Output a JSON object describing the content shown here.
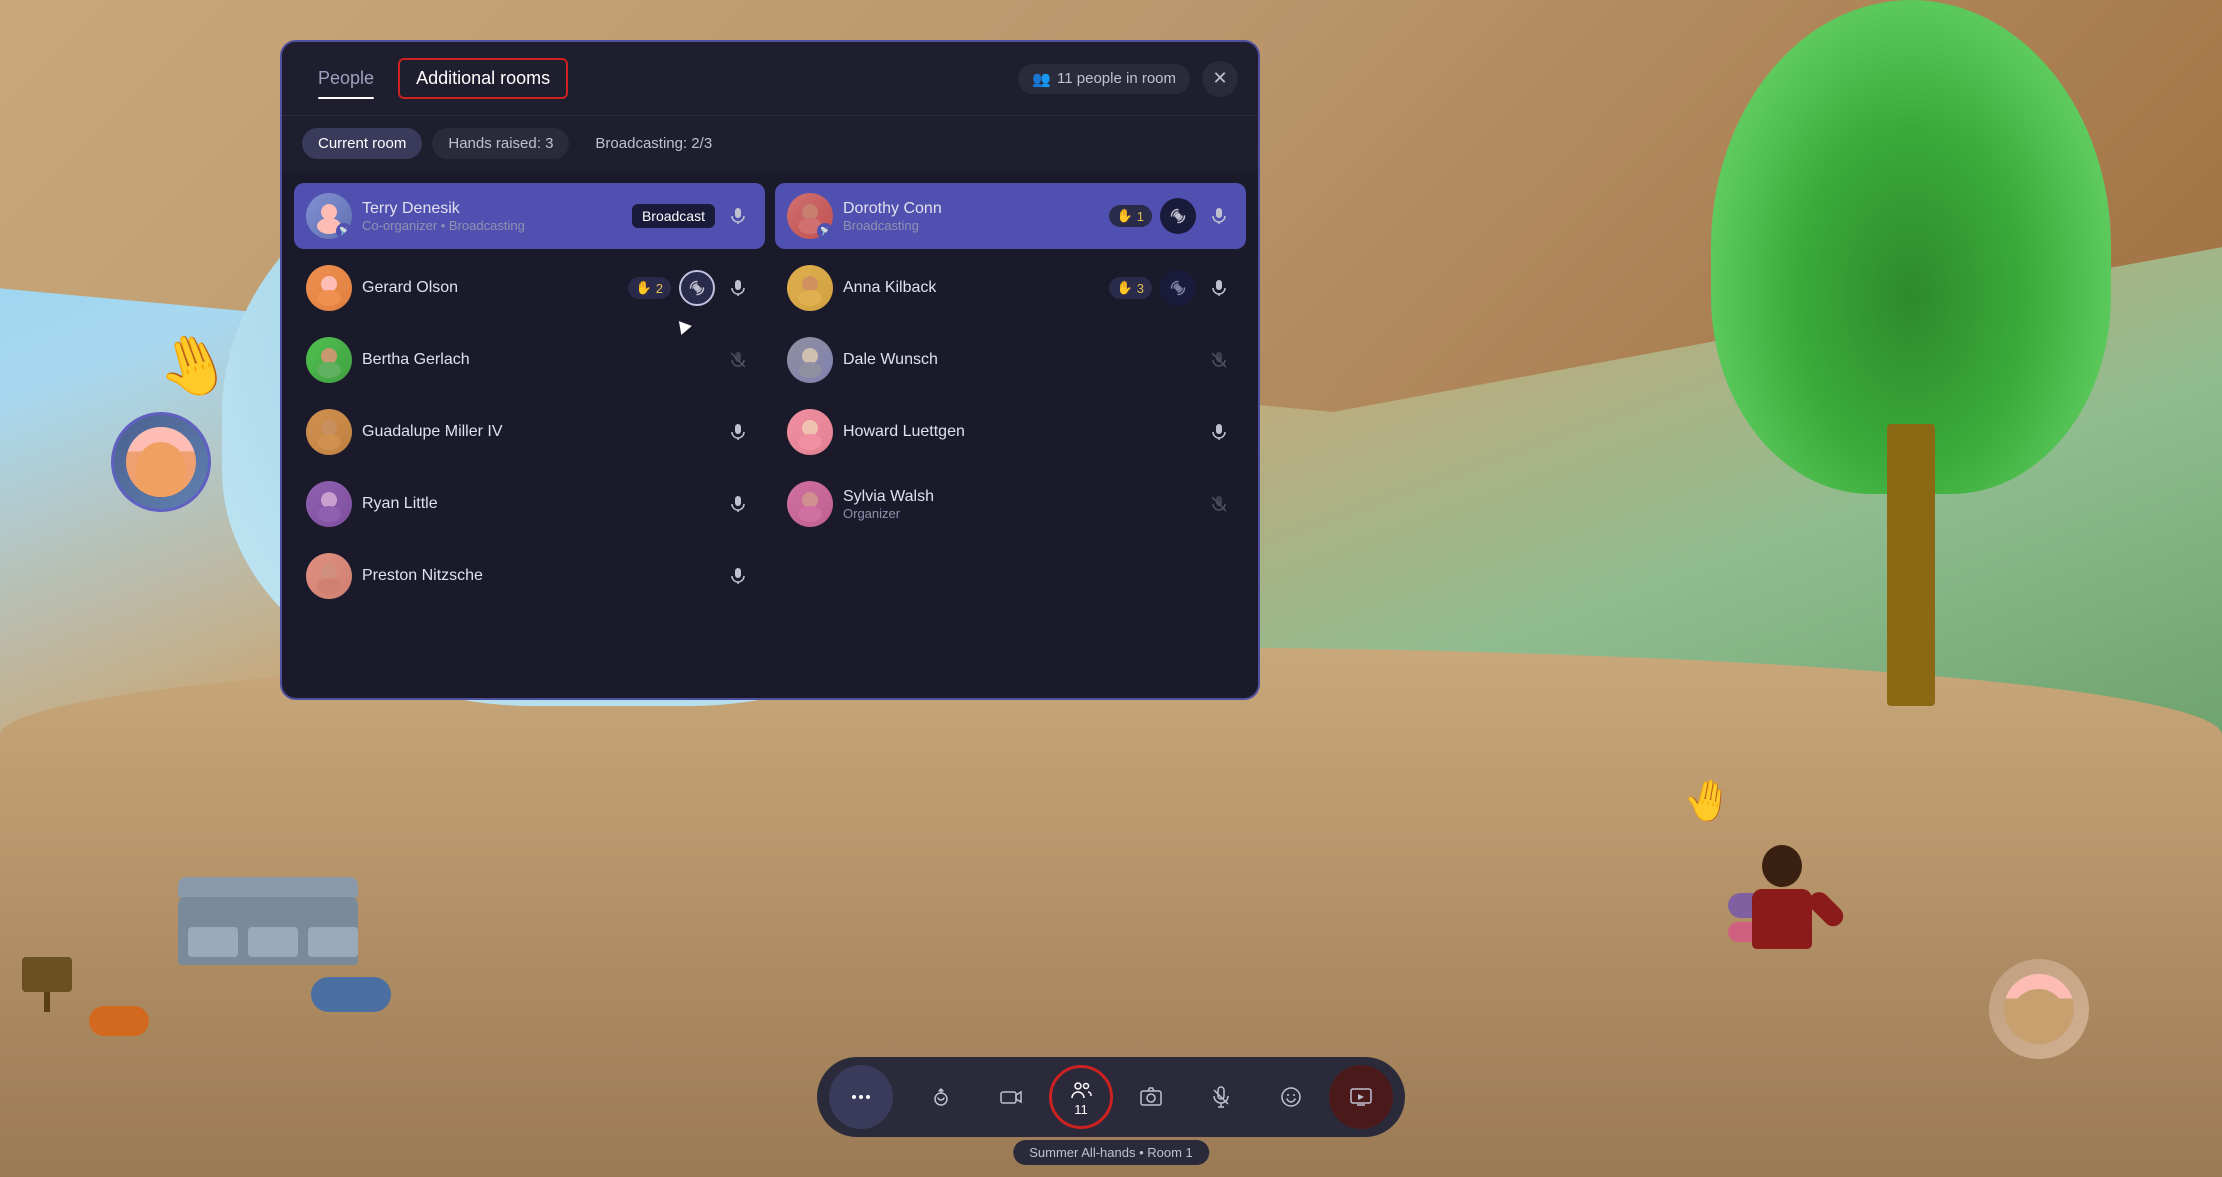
{
  "background": {
    "alt": "Virtual meeting room background"
  },
  "panel": {
    "tabs": [
      {
        "id": "people",
        "label": "People",
        "active": false
      },
      {
        "id": "additional-rooms",
        "label": "Additional rooms",
        "active": true
      }
    ],
    "people_count": "11 people in room",
    "close_label": "✕",
    "filters": [
      {
        "id": "current-room",
        "label": "Current room",
        "active": true
      },
      {
        "id": "hands-raised",
        "label": "Hands raised: 3",
        "active": false
      },
      {
        "id": "broadcasting",
        "label": "Broadcasting: 2/3",
        "active": false
      }
    ]
  },
  "left_column": {
    "people": [
      {
        "id": "terry",
        "name": "Terry Denesik",
        "role": "Co-organizer • Broadcasting",
        "avatar_class": "av-terry",
        "avatar_emoji": "👤",
        "is_broadcasting": true,
        "has_broadcast_badge": true,
        "broadcast_badge_label": "Broadcast",
        "mic_active": true,
        "hand_count": null,
        "show_broadcast_ring": false
      },
      {
        "id": "gerard",
        "name": "Gerard Olson",
        "role": "",
        "avatar_class": "av-gerard",
        "avatar_emoji": "👤",
        "is_broadcasting": false,
        "has_broadcast_badge": false,
        "mic_active": true,
        "hand_count": "2",
        "show_broadcast_ring": true
      },
      {
        "id": "bertha",
        "name": "Bertha Gerlach",
        "role": "",
        "avatar_class": "av-bertha",
        "avatar_emoji": "👤",
        "is_broadcasting": false,
        "has_broadcast_badge": false,
        "mic_active": false,
        "hand_count": null,
        "show_broadcast_ring": false
      },
      {
        "id": "guadalupe",
        "name": "Guadalupe Miller IV",
        "role": "",
        "avatar_class": "av-guadalupe",
        "avatar_emoji": "👤",
        "is_broadcasting": false,
        "has_broadcast_badge": false,
        "mic_active": true,
        "hand_count": null,
        "show_broadcast_ring": false
      },
      {
        "id": "ryan",
        "name": "Ryan Little",
        "role": "",
        "avatar_class": "av-ryan",
        "avatar_emoji": "👤",
        "is_broadcasting": false,
        "has_broadcast_badge": false,
        "mic_active": true,
        "hand_count": null,
        "show_broadcast_ring": false
      },
      {
        "id": "preston",
        "name": "Preston Nitzsche",
        "role": "",
        "avatar_class": "av-preston",
        "avatar_emoji": "👤",
        "is_broadcasting": false,
        "has_broadcast_badge": false,
        "mic_active": true,
        "hand_count": null,
        "show_broadcast_ring": false
      }
    ]
  },
  "right_column": {
    "people": [
      {
        "id": "dorothy",
        "name": "Dorothy Conn",
        "role": "Broadcasting",
        "avatar_class": "av-dorothy",
        "avatar_emoji": "👤",
        "is_broadcasting": true,
        "has_broadcast_badge": false,
        "mic_active": true,
        "hand_count": "1",
        "show_broadcast_icon": true
      },
      {
        "id": "anna",
        "name": "Anna Kilback",
        "role": "",
        "avatar_class": "av-anna",
        "avatar_emoji": "👤",
        "is_broadcasting": false,
        "has_broadcast_badge": false,
        "mic_active": true,
        "hand_count": "3",
        "show_broadcast_icon": true
      },
      {
        "id": "dale",
        "name": "Dale Wunsch",
        "role": "",
        "avatar_class": "av-dale",
        "avatar_emoji": "👤",
        "is_broadcasting": false,
        "has_broadcast_badge": false,
        "mic_active": false,
        "hand_count": null,
        "show_broadcast_icon": false
      },
      {
        "id": "howard",
        "name": "Howard Luettgen",
        "role": "",
        "avatar_class": "av-howard",
        "avatar_emoji": "👤",
        "is_broadcasting": false,
        "has_broadcast_badge": false,
        "mic_active": true,
        "hand_count": null,
        "show_broadcast_icon": false
      },
      {
        "id": "sylvia",
        "name": "Sylvia Walsh",
        "role": "Organizer",
        "avatar_class": "av-sylvia",
        "avatar_emoji": "👤",
        "is_broadcasting": false,
        "has_broadcast_badge": false,
        "mic_active": false,
        "hand_count": null,
        "show_broadcast_icon": false
      }
    ]
  },
  "toolbar": {
    "buttons": [
      {
        "id": "menu",
        "icon": "⋯",
        "label": "",
        "is_dots": true
      },
      {
        "id": "reactions",
        "icon": "↑",
        "label": "reactions"
      },
      {
        "id": "camera",
        "icon": "🎬",
        "label": "camera"
      },
      {
        "id": "people",
        "icon": "👥",
        "label": "people",
        "count": "11",
        "has_red_border": true
      },
      {
        "id": "photo",
        "icon": "📷",
        "label": "photo"
      },
      {
        "id": "mic",
        "icon": "🎤",
        "label": "mic"
      },
      {
        "id": "emoji",
        "icon": "😊",
        "label": "emoji"
      },
      {
        "id": "screen",
        "icon": "📱",
        "label": "screen",
        "is_dark_red": true
      }
    ],
    "status_label": "Summer All-hands • Room 1"
  }
}
